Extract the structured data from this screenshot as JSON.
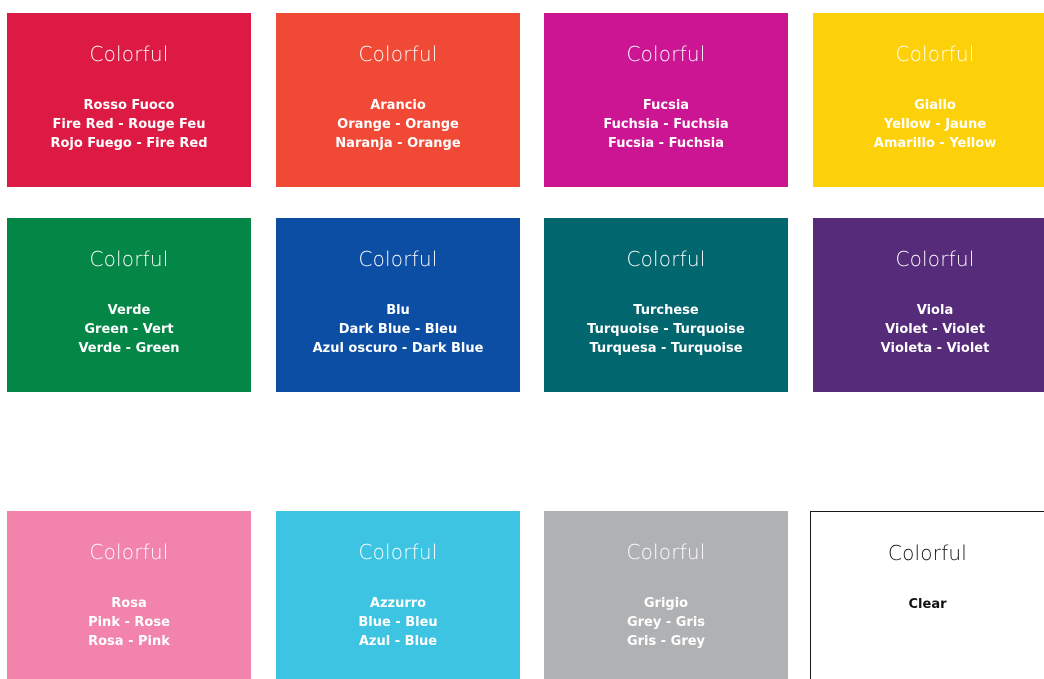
{
  "swatches": [
    {
      "brand": "Colorful",
      "lines": [
        "Rosso Fuoco",
        "Fire Red - Rouge Feu",
        "Rojo Fuego - Fire Red"
      ],
      "color": "#dc1a43"
    },
    {
      "brand": "Colorful",
      "lines": [
        "Arancio",
        "Orange - Orange",
        "Naranja - Orange"
      ],
      "color": "#f04a37"
    },
    {
      "brand": "Colorful",
      "lines": [
        "Fucsia",
        "Fuchsia - Fuchsia",
        "Fucsia - Fuchsia"
      ],
      "color": "#cb1593"
    },
    {
      "brand": "Colorful",
      "lines": [
        "Giallo",
        "Yellow - Jaune",
        "Amarillo - Yellow"
      ],
      "color": "#fdd109"
    },
    {
      "brand": "Colorful",
      "lines": [
        "Verde",
        "Green - Vert",
        "Verde - Green"
      ],
      "color": "#048746"
    },
    {
      "brand": "Colorful",
      "lines": [
        "Blu",
        "Dark Blue - Bleu",
        "Azul oscuro - Dark Blue"
      ],
      "color": "#0c4ea3"
    },
    {
      "brand": "Colorful",
      "lines": [
        "Turchese",
        "Turquoise - Turquoise",
        "Turquesa - Turquoise"
      ],
      "color": "#02666f"
    },
    {
      "brand": "Colorful",
      "lines": [
        "Viola",
        "Violet - Violet",
        "Violeta - Violet"
      ],
      "color": "#552b7a"
    },
    {
      "brand": "Colorful",
      "lines": [
        "Rosa",
        "Pink - Rose",
        "Rosa - Pink"
      ],
      "color": "#f283ab"
    },
    {
      "brand": "Colorful",
      "lines": [
        "Azzurro",
        "Blue - Bleu",
        "Azul - Blue"
      ],
      "color": "#3cc4e2"
    },
    {
      "brand": "Colorful",
      "lines": [
        "Grigio",
        "Grey - Gris",
        "Gris - Grey"
      ],
      "color": "#b0b1b3"
    },
    {
      "brand": "Colorful",
      "lines": [
        "Clear"
      ],
      "color": "#ffffff"
    }
  ]
}
